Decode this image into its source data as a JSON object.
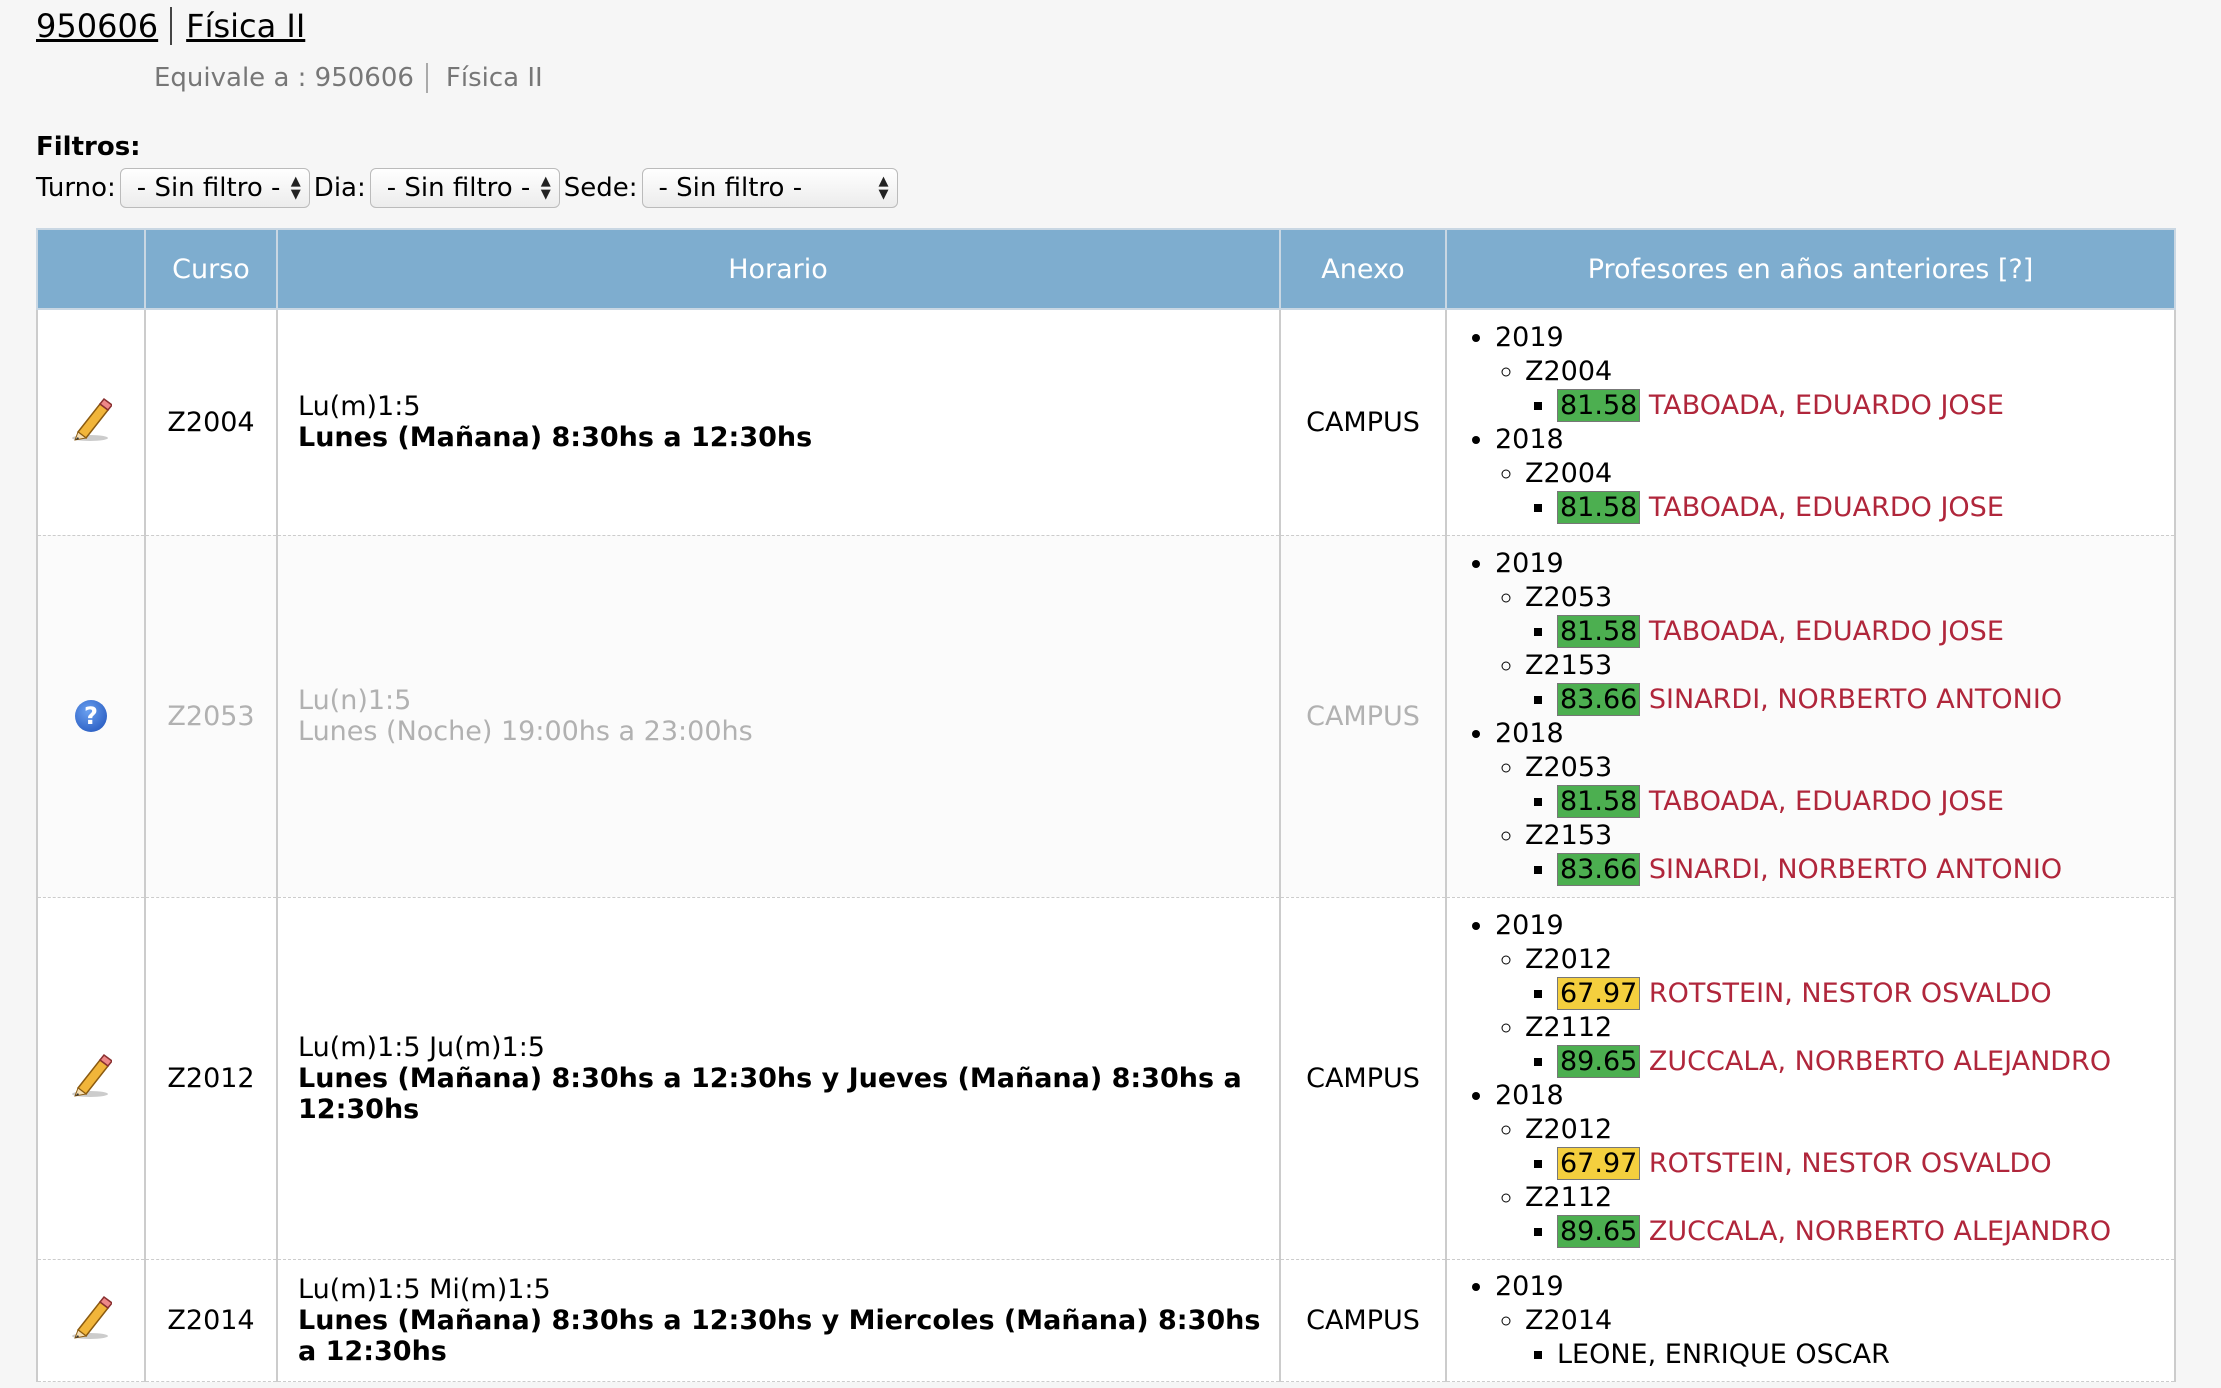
{
  "header": {
    "code": "950606",
    "name": "Física II",
    "equivale_label": "Equivale a : 950606",
    "equivale_name": "Física II"
  },
  "filters": {
    "label": "Filtros:",
    "turno_label": "Turno:",
    "turno_value": "- Sin filtro -",
    "dia_label": "Dia:",
    "dia_value": "- Sin filtro -",
    "sede_label": "Sede:",
    "sede_value": "- Sin filtro -"
  },
  "table": {
    "headers": [
      "",
      "Curso",
      "Horario",
      "Anexo",
      "Profesores en años anteriores [?]"
    ],
    "rows": [
      {
        "icon": "pencil-icon",
        "curso": "Z2004",
        "horario_code": "Lu(m)1:5",
        "horario_text": "Lunes (Mañana) 8:30hs a 12:30hs",
        "anexo": "CAMPUS",
        "history": [
          {
            "year": "2019",
            "courses": [
              {
                "code": "Z2004",
                "profs": [
                  {
                    "score": "81.58",
                    "color": "#4caf50",
                    "name": "TABOADA, EDUARDO JOSE"
                  }
                ]
              }
            ]
          },
          {
            "year": "2018",
            "courses": [
              {
                "code": "Z2004",
                "profs": [
                  {
                    "score": "81.58",
                    "color": "#4caf50",
                    "name": "TABOADA, EDUARDO JOSE"
                  }
                ]
              }
            ]
          }
        ]
      },
      {
        "icon": "question-icon",
        "curso": "Z2053",
        "horario_code": "Lu(n)1:5",
        "horario_text": "Lunes (Noche) 19:00hs a 23:00hs",
        "anexo": "CAMPUS",
        "history": [
          {
            "year": "2019",
            "courses": [
              {
                "code": "Z2053",
                "profs": [
                  {
                    "score": "81.58",
                    "color": "#4caf50",
                    "name": "TABOADA, EDUARDO JOSE"
                  }
                ]
              },
              {
                "code": "Z2153",
                "profs": [
                  {
                    "score": "83.66",
                    "color": "#4caf50",
                    "name": "SINARDI, NORBERTO ANTONIO"
                  }
                ]
              }
            ]
          },
          {
            "year": "2018",
            "courses": [
              {
                "code": "Z2053",
                "profs": [
                  {
                    "score": "81.58",
                    "color": "#4caf50",
                    "name": "TABOADA, EDUARDO JOSE"
                  }
                ]
              },
              {
                "code": "Z2153",
                "profs": [
                  {
                    "score": "83.66",
                    "color": "#4caf50",
                    "name": "SINARDI, NORBERTO ANTONIO"
                  }
                ]
              }
            ]
          }
        ]
      },
      {
        "icon": "pencil-icon",
        "curso": "Z2012",
        "horario_code": "Lu(m)1:5 Ju(m)1:5",
        "horario_text": "Lunes (Mañana) 8:30hs a 12:30hs y Jueves (Mañana) 8:30hs a 12:30hs",
        "anexo": "CAMPUS",
        "history": [
          {
            "year": "2019",
            "courses": [
              {
                "code": "Z2012",
                "profs": [
                  {
                    "score": "67.97",
                    "color": "#f4cf3e",
                    "name": "ROTSTEIN, NESTOR OSVALDO"
                  }
                ]
              },
              {
                "code": "Z2112",
                "profs": [
                  {
                    "score": "89.65",
                    "color": "#4caf50",
                    "name": "ZUCCALA, NORBERTO ALEJANDRO"
                  }
                ]
              }
            ]
          },
          {
            "year": "2018",
            "courses": [
              {
                "code": "Z2012",
                "profs": [
                  {
                    "score": "67.97",
                    "color": "#f4cf3e",
                    "name": "ROTSTEIN, NESTOR OSVALDO"
                  }
                ]
              },
              {
                "code": "Z2112",
                "profs": [
                  {
                    "score": "89.65",
                    "color": "#4caf50",
                    "name": "ZUCCALA, NORBERTO ALEJANDRO"
                  }
                ]
              }
            ]
          }
        ]
      },
      {
        "icon": "pencil-icon",
        "curso": "Z2014",
        "horario_code": "Lu(m)1:5 Mi(m)1:5",
        "horario_text": "Lunes (Mañana) 8:30hs a 12:30hs y Miercoles (Mañana) 8:30hs a 12:30hs",
        "anexo": "CAMPUS",
        "history": [
          {
            "year": "2019",
            "courses": [
              {
                "code": "Z2014",
                "profs": [
                  {
                    "score": "",
                    "color": "",
                    "name": "LEONE, ENRIQUE OSCAR"
                  }
                ]
              }
            ]
          }
        ]
      }
    ]
  }
}
